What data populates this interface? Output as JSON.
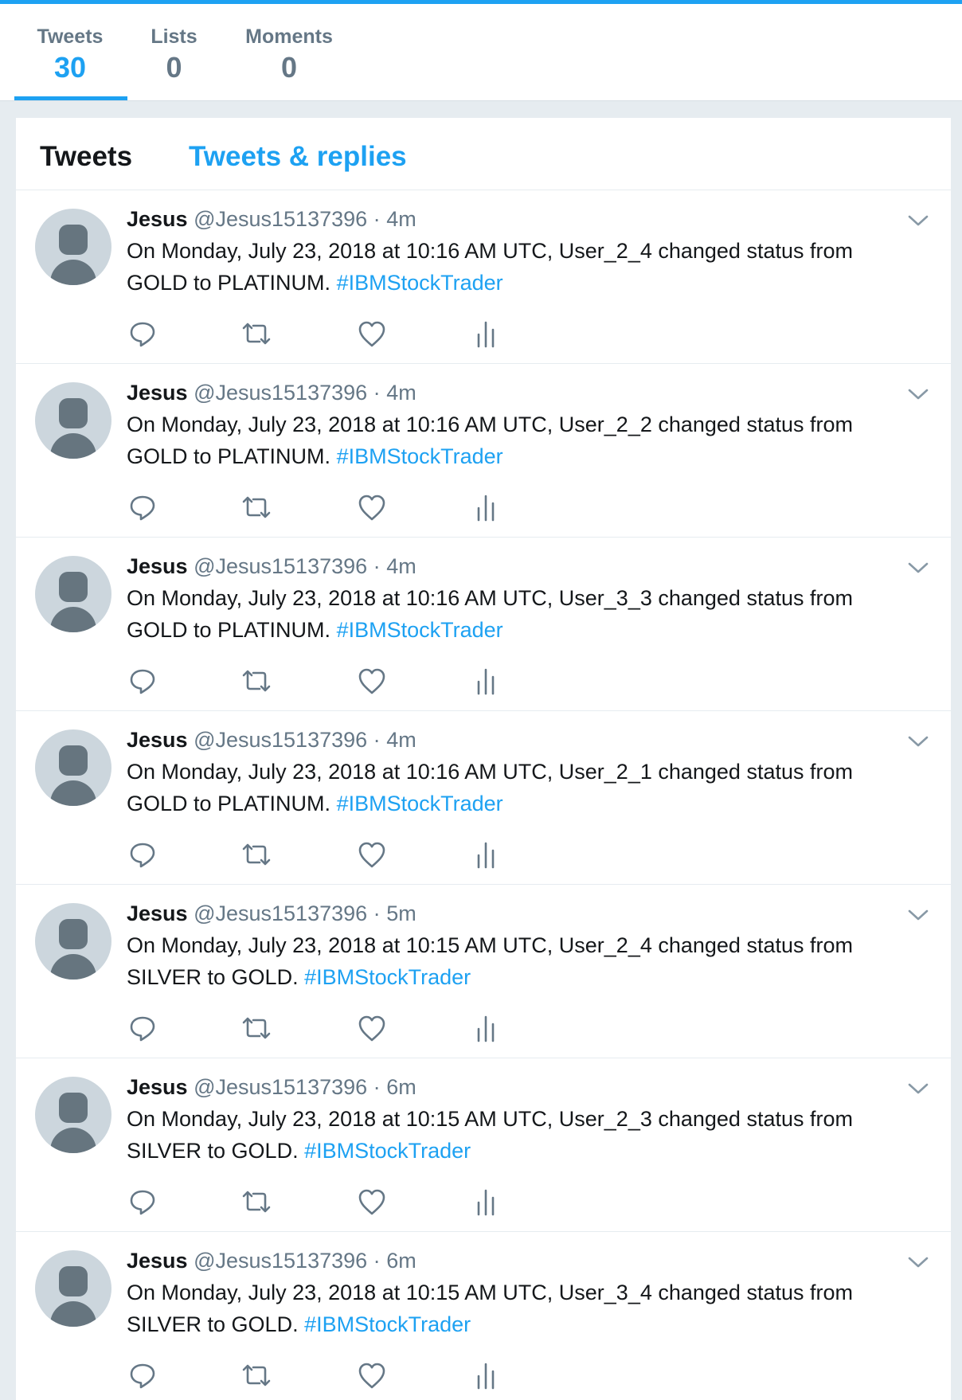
{
  "nav": {
    "items": [
      {
        "label": "Tweets",
        "value": "30",
        "active": true
      },
      {
        "label": "Lists",
        "value": "0",
        "active": false
      },
      {
        "label": "Moments",
        "value": "0",
        "active": false
      }
    ]
  },
  "timeline": {
    "tabs": [
      {
        "label": "Tweets",
        "active": true
      },
      {
        "label": "Tweets & replies",
        "active": false
      }
    ],
    "tweets": [
      {
        "name": "Jesus",
        "handle": "@Jesus15137396",
        "dot": "·",
        "time": "4m",
        "text": "On Monday, July 23, 2018 at 10:16 AM UTC, User_2_4 changed status from GOLD to PLATINUM.",
        "hashtag": "#IBMStockTrader"
      },
      {
        "name": "Jesus",
        "handle": "@Jesus15137396",
        "dot": "·",
        "time": "4m",
        "text": "On Monday, July 23, 2018 at 10:16 AM UTC, User_2_2 changed status from GOLD to PLATINUM.",
        "hashtag": "#IBMStockTrader"
      },
      {
        "name": "Jesus",
        "handle": "@Jesus15137396",
        "dot": "·",
        "time": "4m",
        "text": "On Monday, July 23, 2018 at 10:16 AM UTC, User_3_3 changed status from GOLD to PLATINUM.",
        "hashtag": "#IBMStockTrader"
      },
      {
        "name": "Jesus",
        "handle": "@Jesus15137396",
        "dot": "·",
        "time": "4m",
        "text": "On Monday, July 23, 2018 at 10:16 AM UTC, User_2_1 changed status from GOLD to PLATINUM.",
        "hashtag": "#IBMStockTrader"
      },
      {
        "name": "Jesus",
        "handle": "@Jesus15137396",
        "dot": "·",
        "time": "5m",
        "text": "On Monday, July 23, 2018 at 10:15 AM UTC, User_2_4 changed status from SILVER to GOLD.",
        "hashtag": "#IBMStockTrader"
      },
      {
        "name": "Jesus",
        "handle": "@Jesus15137396",
        "dot": "·",
        "time": "6m",
        "text": "On Monday, July 23, 2018 at 10:15 AM UTC, User_2_3 changed status from SILVER to GOLD.",
        "hashtag": "#IBMStockTrader"
      },
      {
        "name": "Jesus",
        "handle": "@Jesus15137396",
        "dot": "·",
        "time": "6m",
        "text": "On Monday, July 23, 2018 at 10:15 AM UTC, User_3_4 changed status from SILVER to GOLD.",
        "hashtag": "#IBMStockTrader"
      }
    ]
  },
  "icons": {
    "reply": "reply-icon",
    "retweet": "retweet-icon",
    "like": "heart-icon",
    "analytics": "analytics-icon",
    "more": "chevron-down-icon"
  },
  "colors": {
    "accent": "#1da1f2",
    "secondary_text": "#657786",
    "background": "#e6ecf0"
  }
}
